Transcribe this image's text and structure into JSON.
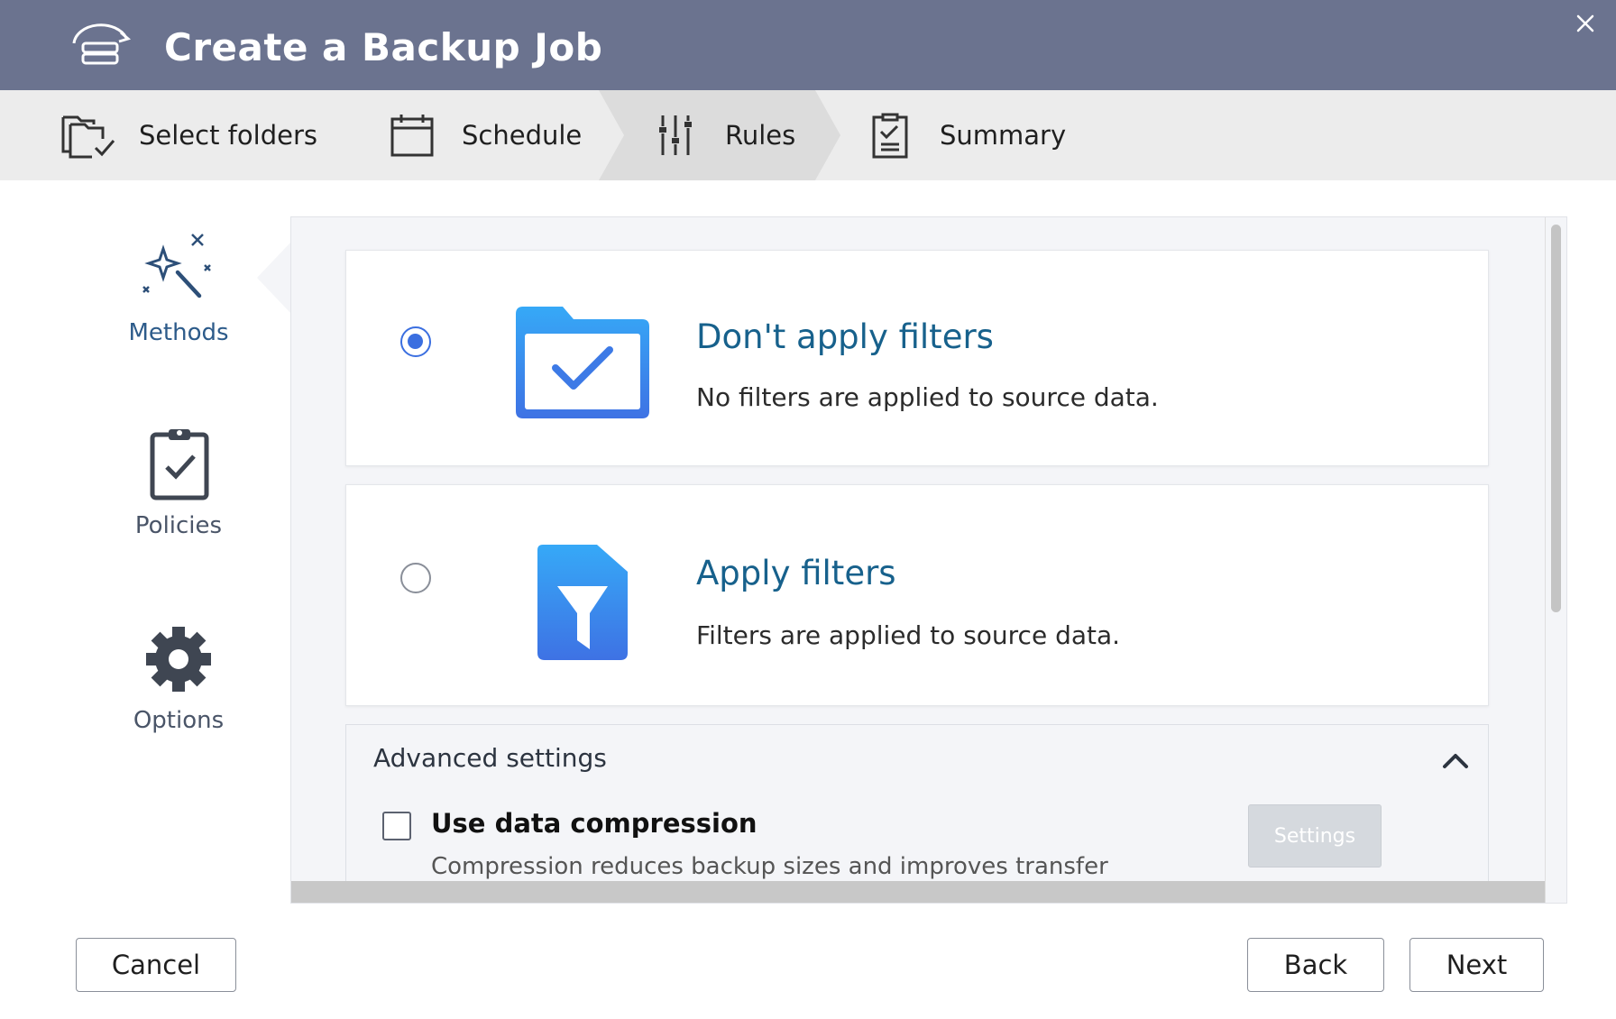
{
  "header": {
    "title": "Create a Backup Job",
    "app_icon": "backup-drive-icon",
    "close_icon": "close-icon",
    "background": "#6b738f"
  },
  "steps": [
    {
      "label": "Select folders",
      "icon": "folder-check-icon",
      "active": false
    },
    {
      "label": "Schedule",
      "icon": "calendar-icon",
      "active": false
    },
    {
      "label": "Rules",
      "icon": "sliders-icon",
      "active": true
    },
    {
      "label": "Summary",
      "icon": "checklist-icon",
      "active": false
    }
  ],
  "sidenav": [
    {
      "label": "Methods",
      "icon": "magic-wand-icon",
      "active": true
    },
    {
      "label": "Policies",
      "icon": "clipboard-check-icon",
      "active": false
    },
    {
      "label": "Options",
      "icon": "gear-icon",
      "active": false
    }
  ],
  "methods": {
    "options": [
      {
        "title": "Don't apply filters",
        "description": "No filters are applied to source data.",
        "icon": "folder-check-icon",
        "selected": true
      },
      {
        "title": "Apply filters",
        "description": "Filters are applied to source data.",
        "icon": "file-filter-icon",
        "selected": false
      }
    ],
    "advanced": {
      "title": "Advanced settings",
      "expanded": true,
      "compression": {
        "label": "Use data compression",
        "description": "Compression reduces backup sizes and improves transfer",
        "checked": false,
        "settings_label": "Settings"
      }
    }
  },
  "footer": {
    "cancel_label": "Cancel",
    "back_label": "Back",
    "next_label": "Next"
  },
  "colors": {
    "accent": "#3b6fe0",
    "title_blue": "#17618c",
    "header": "#6b738f"
  }
}
